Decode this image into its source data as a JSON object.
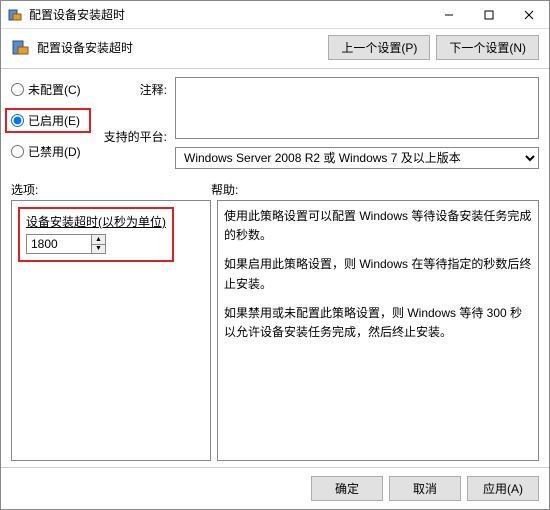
{
  "titlebar": {
    "title": "配置设备安装超时"
  },
  "header": {
    "title": "配置设备安装超时",
    "prev": "上一个设置(P)",
    "next": "下一个设置(N)"
  },
  "radios": {
    "not_configured": "未配置(C)",
    "enabled": "已启用(E)",
    "disabled": "已禁用(D)"
  },
  "labels": {
    "comment": "注释:",
    "platform": "支持的平台:",
    "options": "选项:",
    "help": "帮助:"
  },
  "comment_value": "",
  "platform_value": "Windows Server 2008 R2 或 Windows 7 及以上版本",
  "option": {
    "label": "设备安装超时(以秒为单位)",
    "value": "1800"
  },
  "help": {
    "p1": "使用此策略设置可以配置 Windows 等待设备安装任务完成的秒数。",
    "p2": "如果启用此策略设置，则 Windows 在等待指定的秒数后终止安装。",
    "p3": "如果禁用或未配置此策略设置，则 Windows 等待 300 秒以允许设备安装任务完成，然后终止安装。"
  },
  "footer": {
    "ok": "确定",
    "cancel": "取消",
    "apply": "应用(A)"
  }
}
